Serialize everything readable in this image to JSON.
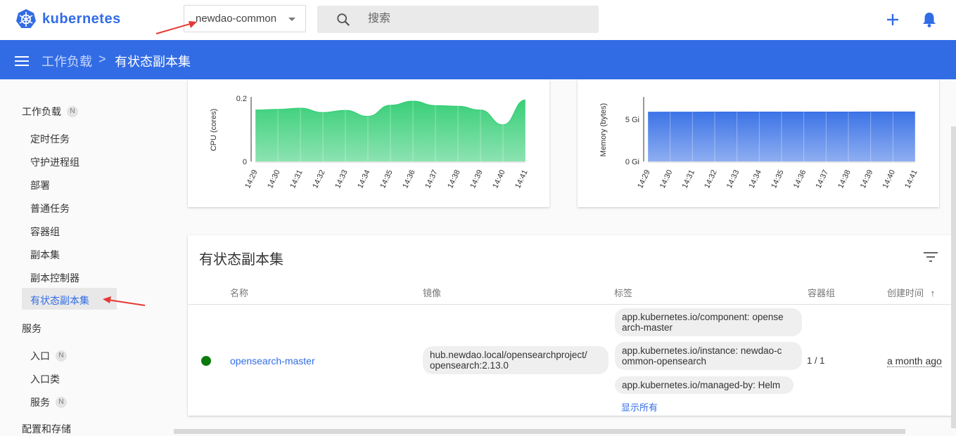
{
  "header": {
    "logo_text": "kubernetes",
    "namespace": "newdao-common",
    "search_placeholder": "搜索",
    "accent_color": "#326ce5"
  },
  "breadcrumb": {
    "parent": "工作负载",
    "separator": ">",
    "current": "有状态副本集"
  },
  "sidebar": {
    "workloads": "工作负载",
    "workloads_badge": "N",
    "items": [
      {
        "label": "定时任务"
      },
      {
        "label": "守护进程组"
      },
      {
        "label": "部署"
      },
      {
        "label": "普通任务"
      },
      {
        "label": "容器组"
      },
      {
        "label": "副本集"
      },
      {
        "label": "副本控制器"
      },
      {
        "label": "有状态副本集"
      }
    ],
    "services": "服务",
    "service_items": [
      {
        "label": "入口",
        "badge": "N"
      },
      {
        "label": "入口类"
      },
      {
        "label": "服务",
        "badge": "N"
      }
    ],
    "config": "配置和存储"
  },
  "chart_data": [
    {
      "type": "area",
      "ylabel": "CPU (cores)",
      "xlabel": "",
      "ylim": [
        0,
        0.2
      ],
      "yticks": [
        "0",
        "0.2"
      ],
      "x": [
        "14:29",
        "14:30",
        "14:31",
        "14:32",
        "14:33",
        "14:34",
        "14:35",
        "14:36",
        "14:37",
        "14:38",
        "14:39",
        "14:40",
        "14:41"
      ],
      "values": [
        0.163,
        0.165,
        0.169,
        0.155,
        0.162,
        0.143,
        0.178,
        0.191,
        0.177,
        0.175,
        0.163,
        0.116,
        0.195
      ],
      "color": "#2ecc71"
    },
    {
      "type": "area",
      "ylabel": "Memory (bytes)",
      "xlabel": "",
      "ylim": [
        0,
        7.5
      ],
      "yticks": [
        "0 Gi",
        "5 Gi"
      ],
      "x": [
        "14:29",
        "14:30",
        "14:31",
        "14:32",
        "14:33",
        "14:34",
        "14:35",
        "14:36",
        "14:37",
        "14:38",
        "14:39",
        "14:40",
        "14:41"
      ],
      "values": [
        5.85,
        5.86,
        5.86,
        5.87,
        5.87,
        5.87,
        5.88,
        5.88,
        5.88,
        5.88,
        5.89,
        5.89,
        5.89
      ],
      "color": "#326ce5"
    }
  ],
  "table": {
    "title": "有状态副本集",
    "columns": {
      "name": "名称",
      "image": "镜像",
      "labels": "标签",
      "pods": "容器组",
      "created": "创建时间"
    },
    "sort_arrow": "↑",
    "row": {
      "name": "opensearch-master",
      "image_line1": "hub.newdao.local/opensearchproject/",
      "image_line2": "opensearch:2.13.0",
      "label1_line1": "app.kubernetes.io/component: opense",
      "label1_line2": "arch-master",
      "label2_line1": "app.kubernetes.io/instance: newdao-c",
      "label2_line2": "ommon-opensearch",
      "label3": "app.kubernetes.io/managed-by: Helm",
      "show_all": "显示所有",
      "pods": "1 / 1",
      "created": "a month ago",
      "status_color": "#0b7a0b"
    }
  }
}
